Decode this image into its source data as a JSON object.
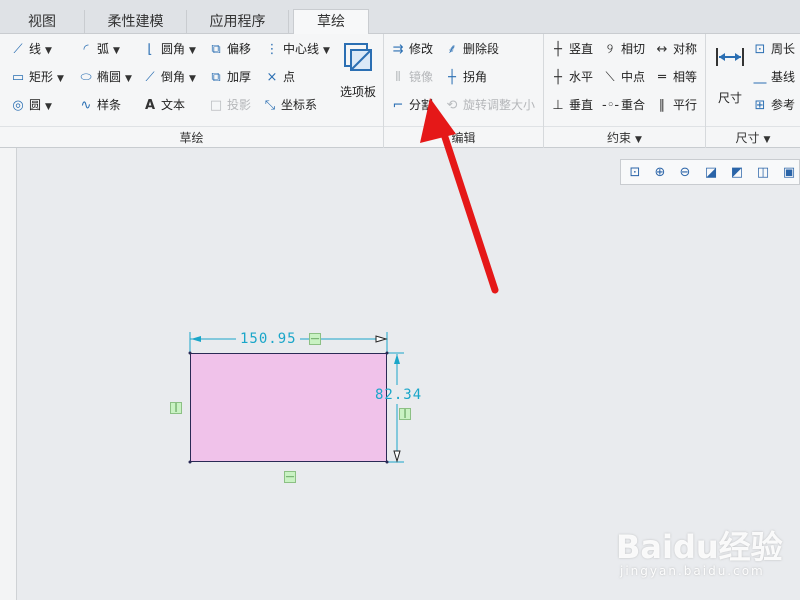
{
  "tabs": [
    "视图",
    "柔性建模",
    "应用程序",
    "草绘"
  ],
  "ribbon": {
    "sketch_group": {
      "label": "草绘",
      "items": {
        "line": "线",
        "arc": "弧",
        "fillet": "圆角",
        "offset": "偏移",
        "centerline": "中心线",
        "rectangle": "矩形",
        "ellipse": "椭圆",
        "chamfer": "倒角",
        "thicken": "加厚",
        "point": "点",
        "circle": "圆",
        "spline": "样条",
        "text": "文本",
        "project": "投影",
        "coordinate_system": "坐标系",
        "palette": "选项板"
      }
    },
    "edit_group": {
      "label": "编辑",
      "items": {
        "modify": "修改",
        "delete_segment": "删除段",
        "mirror": "镜像",
        "corner": "拐角",
        "divide": "分割",
        "rotate_resize": "旋转调整大小"
      }
    },
    "constrain_group": {
      "label": "约束",
      "items": {
        "vertical": "竖直",
        "tangent": "相切",
        "symmetric": "对称",
        "horizontal": "水平",
        "midpoint": "中点",
        "equal": "相等",
        "perpendicular": "垂直",
        "coincident": "重合",
        "parallel": "平行"
      }
    },
    "dimension_group": {
      "label": "尺寸",
      "items": {
        "dimension": "尺寸",
        "perimeter": "周长",
        "baseline": "基线",
        "reference": "参考"
      }
    }
  },
  "sketch": {
    "width_dim": "150.95",
    "height_dim": "82.34",
    "fill_color": "#f0c2ea",
    "dim_color": "#1aa6c9"
  },
  "watermark": {
    "brand": "Baidu经验",
    "url": "jingyan.baidu.com"
  }
}
